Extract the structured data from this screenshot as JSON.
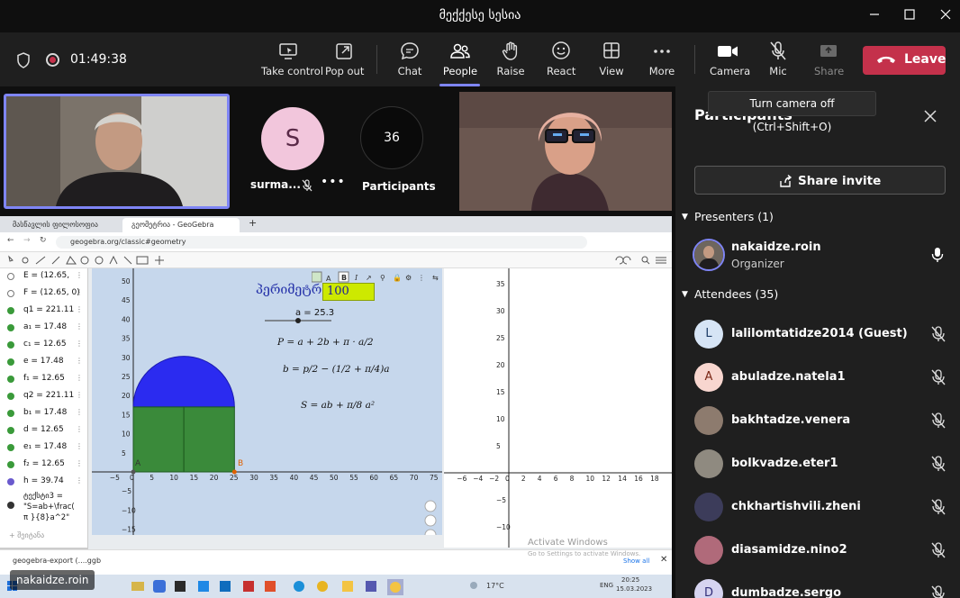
{
  "window": {
    "title": "მექქესე სესია"
  },
  "toolbar": {
    "timer": "01:49:38",
    "buttons": {
      "take_control": "Take control",
      "pop_out": "Pop out",
      "chat": "Chat",
      "people": "People",
      "raise": "Raise",
      "react": "React",
      "view": "View",
      "more": "More",
      "camera": "Camera",
      "mic": "Mic",
      "share": "Share"
    },
    "leave": "Leave",
    "accent": "#7f85f5",
    "leave_color": "#c4314b"
  },
  "stage": {
    "tile_s": {
      "initial": "S",
      "name": "surma..."
    },
    "participants_tile": {
      "count": "36",
      "label": "Participants"
    },
    "screen_owner_badge": "nakaidze.roin"
  },
  "shared_screen": {
    "tabs": [
      "მასწავლის ფილოსოფია მზადების",
      "გეომეტრია - GeoGebra"
    ],
    "url": "geogebra.org/classic#geometry",
    "algebra": [
      {
        "label": "E = (12.65,",
        "color": "#ffffff"
      },
      {
        "label": "F = (12.65, 0)",
        "color": "#ffffff"
      },
      {
        "label": "q1 = 221.11",
        "color": "#3a9a3a"
      },
      {
        "label": "a₁ = 17.48",
        "color": "#3a9a3a"
      },
      {
        "label": "c₁ = 12.65",
        "color": "#3a9a3a"
      },
      {
        "label": "e = 17.48",
        "color": "#3a9a3a"
      },
      {
        "label": "f₁ = 12.65",
        "color": "#3a9a3a"
      },
      {
        "label": "q2 = 221.11",
        "color": "#3a9a3a"
      },
      {
        "label": "b₁ = 17.48",
        "color": "#3a9a3a"
      },
      {
        "label": "d = 12.65",
        "color": "#3a9a3a"
      },
      {
        "label": "e₁ = 17.48",
        "color": "#3a9a3a"
      },
      {
        "label": "f₂ = 12.65",
        "color": "#3a9a3a"
      },
      {
        "label": "h = 39.74",
        "color": "#6a5acd"
      }
    ],
    "algebra_text": {
      "l1": "ტექსტი3 =",
      "l2": "\"S=ab+\\frac(",
      "l3": "π }{8}a^2\""
    },
    "algebra_input": "+ შეიტანა",
    "perimeter_label": "პერიმეტრი",
    "perimeter_value": "100",
    "slider": "a = 25.3",
    "formula_p": "P = a + 2b + π · a/2",
    "formula_b": "b = p/2 − (1/2 + π/4)a",
    "formula_s": "S = ab + π/8 a²",
    "point_a": "A",
    "point_b": "B",
    "g1_xticks": [
      "−5",
      "0",
      "5",
      "10",
      "15",
      "20",
      "25",
      "30",
      "35",
      "40",
      "45",
      "50",
      "55",
      "60",
      "65",
      "70",
      "75"
    ],
    "g1_yticks": [
      "50",
      "45",
      "40",
      "35",
      "30",
      "25",
      "20",
      "15",
      "10",
      "5",
      "−5",
      "−10",
      "−15"
    ],
    "g2_xticks": [
      "−6",
      "−4",
      "−2",
      "0",
      "2",
      "4",
      "6",
      "8",
      "10",
      "12",
      "14",
      "16",
      "18"
    ],
    "g2_yticks": [
      "35",
      "30",
      "25",
      "20",
      "15",
      "10",
      "5",
      "−5",
      "−10"
    ],
    "download": "geogebra-export (....ggb",
    "show_all": "Show all",
    "watermark1": "Activate Windows",
    "watermark2": "Go to Settings to activate Windows.",
    "taskbar": {
      "temp": "17°C",
      "lang": "ENG",
      "time": "20:25",
      "date": "15.03.2023"
    }
  },
  "panel": {
    "title": "Participants",
    "tooltip": "Turn camera off (Ctrl+Shift+O)",
    "share_invite": "Share invite",
    "presenters_header": "Presenters (1)",
    "attendees_header": "Attendees (35)",
    "presenter": {
      "name": "nakaidze.roin",
      "role": "Organizer"
    },
    "attendees": [
      {
        "name": "lalilomtatidze2014 (Guest)",
        "initial": "L",
        "bg": "#d6e4f5",
        "fg": "#1b3a66"
      },
      {
        "name": "abuladze.natela1",
        "initial": "A",
        "bg": "#f8d6cf",
        "fg": "#7a2716"
      },
      {
        "name": "bakhtadze.venera",
        "initial": "",
        "bg": "#8d7b6e",
        "fg": "#fff"
      },
      {
        "name": "bolkvadze.eter1",
        "initial": "",
        "bg": "#8f8a80",
        "fg": "#fff"
      },
      {
        "name": "chkhartishvili.zheni",
        "initial": "",
        "bg": "#3c3c5a",
        "fg": "#fff"
      },
      {
        "name": "diasamidze.nino2",
        "initial": "",
        "bg": "#b06a7a",
        "fg": "#fff"
      },
      {
        "name": "dumbadze.sergo",
        "initial": "D",
        "bg": "#d6d4f0",
        "fg": "#33307a"
      }
    ]
  }
}
